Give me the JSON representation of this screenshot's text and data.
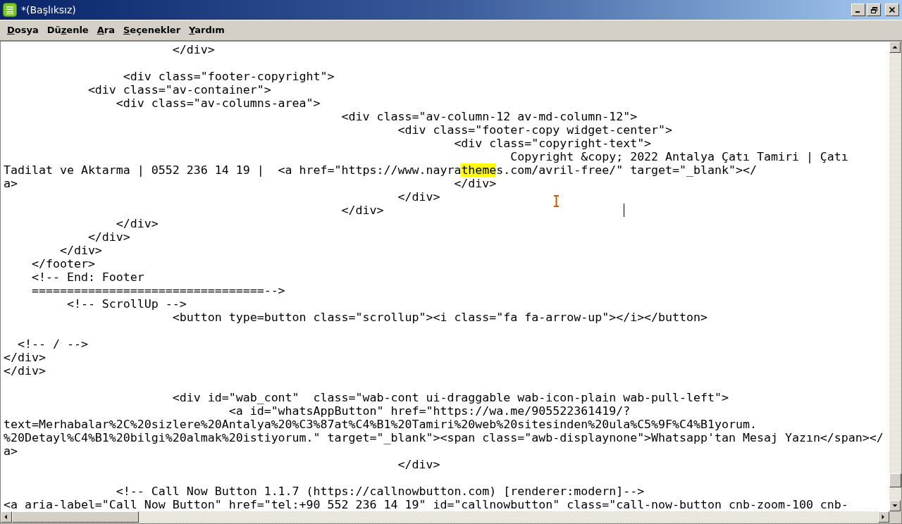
{
  "window": {
    "title": "*(Başlıksız)"
  },
  "menu": [
    {
      "key": "D",
      "post": "osya"
    },
    {
      "pre": "Dü",
      "key": "z",
      "post": "enle"
    },
    {
      "key": "A",
      "post": "ra"
    },
    {
      "key": "S",
      "post": "eçenekler"
    },
    {
      "key": "Y",
      "post": "ardım"
    }
  ],
  "editor": {
    "blocks": [
      [
        {
          "text": "                        </div>"
        }
      ],
      [
        {
          "text": "                 <div class=\"footer-copyright\">"
        },
        {
          "text": "            <div class=\"av-container\">"
        },
        {
          "text": "                <div class=\"av-columns-area\">"
        },
        {
          "text": "                                                <div class=\"av-column-12 av-md-column-12\">"
        },
        {
          "text": "                                                        <div class=\"footer-copy widget-center\">"
        },
        {
          "text": "                                                                <div class=\"copyright-text\">"
        },
        {
          "text": "                                                                        Copyright &copy; 2022 Antalya Çatı Tamiri | Çatı"
        },
        {
          "segments": [
            {
              "text": "Tadilat ve Aktarma | 0552 236 14 19 |  <a href=\"https://www.nayra",
              "highlighted": false
            },
            {
              "text": "theme",
              "highlighted": true
            },
            {
              "text": "s.com/avril-free/\" target=\"_blank\"></",
              "highlighted": false
            }
          ]
        },
        {
          "text": "a>                                                              </div>"
        },
        {
          "text": "                                                        </div>"
        },
        {
          "text": "                                                </div>",
          "caret": true
        },
        {
          "text": "                </div>"
        },
        {
          "text": "            </div>"
        },
        {
          "text": "        </div>"
        },
        {
          "text": "    </footer>"
        },
        {
          "text": "    <!-- End: Footer"
        },
        {
          "text": "    =================================-->"
        },
        {
          "text": "         <!-- ScrollUp -->"
        },
        {
          "text": "                        <button type=button class=\"scrollup\"><i class=\"fa fa-arrow-up\"></i></button>"
        }
      ],
      [
        {
          "text": "  <!-- / -->"
        },
        {
          "text": "</div>"
        },
        {
          "text": "</div>"
        }
      ],
      [
        {
          "text": "                        <div id=\"wab_cont\"  class=\"wab-cont ui-draggable wab-icon-plain wab-pull-left\">"
        },
        {
          "text": "                                <a id=\"whatsAppButton\" href=\"https://wa.me/905522361419/?"
        },
        {
          "text": "text=Merhabalar%2C%20sizlere%20Antalya%20%C3%87at%C4%B1%20Tamiri%20web%20sitesinden%20ula%C5%9F%C4%B1yorum."
        },
        {
          "text": "%20Detayl%C4%B1%20bilgi%20almak%20istiyorum.\" target=\"_blank\"><span class=\"awb-displaynone\">Whatsapp'tan Mesaj Yazın</span></"
        },
        {
          "text": "a>"
        },
        {
          "text": "                                                        </div>"
        }
      ],
      [
        {
          "text": "                <!-- Call Now Button 1.1.7 (https://callnowbutton.com) [renderer:modern]-->"
        },
        {
          "text": "<a aria-label=\"Call Now Button\" href=\"tel:+90 552 236 14 19\" id=\"callnowbutton\" class=\"call-now-button cnb-zoom-100 cnb-"
        }
      ]
    ]
  }
}
